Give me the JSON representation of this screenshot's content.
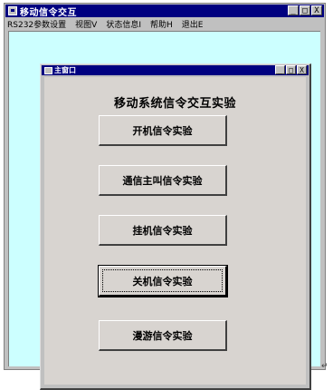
{
  "app": {
    "title": "移动信令交互",
    "controls": {
      "minimize": "_",
      "maximize": "□",
      "close": "X"
    }
  },
  "menu": {
    "items": [
      "RS232参数设置",
      "视图V",
      "状态信息I",
      "帮助H",
      "退出E"
    ]
  },
  "child": {
    "title": "主窗口",
    "controls": {
      "minimize": "_",
      "maximize": "□",
      "close": "X"
    }
  },
  "main": {
    "heading": "移动系统信令交互实验",
    "buttons": [
      "开机信令实验",
      "通信主叫信令实验",
      "挂机信令实验",
      "关机信令实验",
      "漫游信令实验"
    ],
    "focused_button_index": 3
  },
  "page": {
    "trailing_mark": "↵"
  },
  "colors": {
    "titlebar": "#000080",
    "mdi_background": "#ccffff",
    "window_face": "#c0c0c0",
    "client_face": "#d8d4d0"
  }
}
